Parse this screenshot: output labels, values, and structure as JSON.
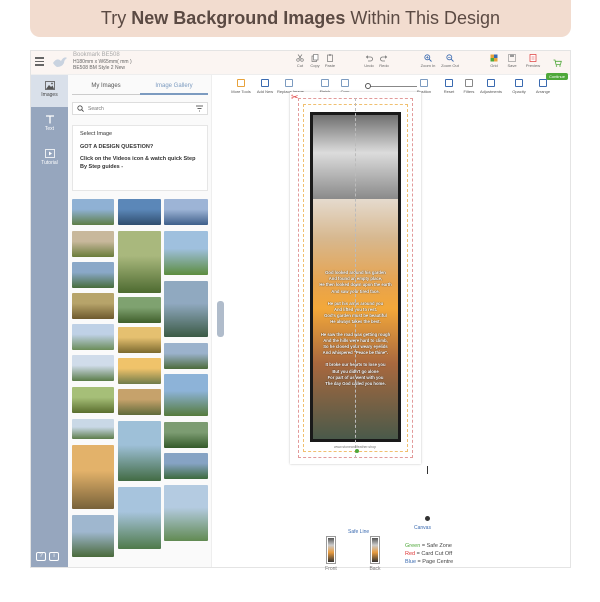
{
  "banner": {
    "prefix": "Try ",
    "highlight": "New Background Images",
    "suffix": " Within This Design"
  },
  "document": {
    "name": "Bookmark BE508",
    "size": "H180mm x W65mm( mm )",
    "style": "BE508 BM Style 2 New"
  },
  "toolbar": [
    {
      "name": "cut",
      "label": "Cut"
    },
    {
      "name": "copy",
      "label": "Copy"
    },
    {
      "name": "paste",
      "label": "Paste"
    },
    {
      "name": "undo",
      "label": "Undo"
    },
    {
      "name": "redo",
      "label": "Redo"
    },
    {
      "name": "zoom-in",
      "label": "Zoom In"
    },
    {
      "name": "zoom-out",
      "label": "Zoom Out"
    },
    {
      "name": "grid",
      "label": "Grid"
    },
    {
      "name": "save",
      "label": "Save"
    },
    {
      "name": "preview",
      "label": "Preview"
    }
  ],
  "continue_label": "Continue",
  "rail": [
    {
      "name": "images",
      "label": "Images"
    },
    {
      "name": "text",
      "label": "Text"
    },
    {
      "name": "tutorial",
      "label": "Tutorial"
    }
  ],
  "panel": {
    "tabs": [
      "My Images",
      "Image Gallery"
    ],
    "active_tab": "Image Gallery",
    "search_placeholder": "Search",
    "select_image": "Select Image",
    "question": "GOT A DESIGN QUESTION?",
    "tip": "Click on the Videos icon & watch quick Step By Step guides -"
  },
  "tools": [
    {
      "name": "more-tools",
      "label": "More Tools"
    },
    {
      "name": "add-new",
      "label": "Add New"
    },
    {
      "name": "replace-image",
      "label": "Replace Image"
    },
    {
      "name": "finish",
      "label": "Finish"
    },
    {
      "name": "crop",
      "label": "Crop"
    },
    {
      "name": "position",
      "label": "Position"
    },
    {
      "name": "reset",
      "label": "Reset"
    },
    {
      "name": "filters",
      "label": "Filters"
    },
    {
      "name": "adjustments",
      "label": "Adjustments"
    },
    {
      "name": "opacity",
      "label": "Opacity"
    },
    {
      "name": "arrange",
      "label": "Arrange"
    }
  ],
  "zoom_label": "Zoom In",
  "poem": [
    [
      "God looked around his garden",
      "And found an empty place,",
      "He then looked down upon the earth",
      "And saw your tired face."
    ],
    [
      "He put his arms around you",
      "And lifted you to rest.",
      "God's garden must be beautiful",
      "He always takes the best."
    ],
    [
      "He saw the road was getting rough",
      "And the hills were hard to climb,",
      "So he closed your weary eyelids",
      "And whispered \"Peace be thine\"."
    ],
    [
      "It broke our hearts to lose you",
      "But you didn't go alone",
      "For part of us went with you",
      "The day God called you home."
    ]
  ],
  "brand": "www.stoneandfeather.shop",
  "labels": {
    "safe_line": "Safe Line",
    "canvas": "Canvas"
  },
  "legend": [
    {
      "color": "Green",
      "meaning": " = Safe Zone"
    },
    {
      "color": "Red",
      "meaning": " = Card Cut Off"
    },
    {
      "color": "Blue",
      "meaning": " = Page Centre"
    }
  ],
  "pages": [
    "Front",
    "Back"
  ],
  "colors": {
    "rail": "#96a6be",
    "accent": "#7c9bc0",
    "continue": "#4fa83a",
    "cut_line": "#e29a9a",
    "safe_line": "#f0c070"
  }
}
